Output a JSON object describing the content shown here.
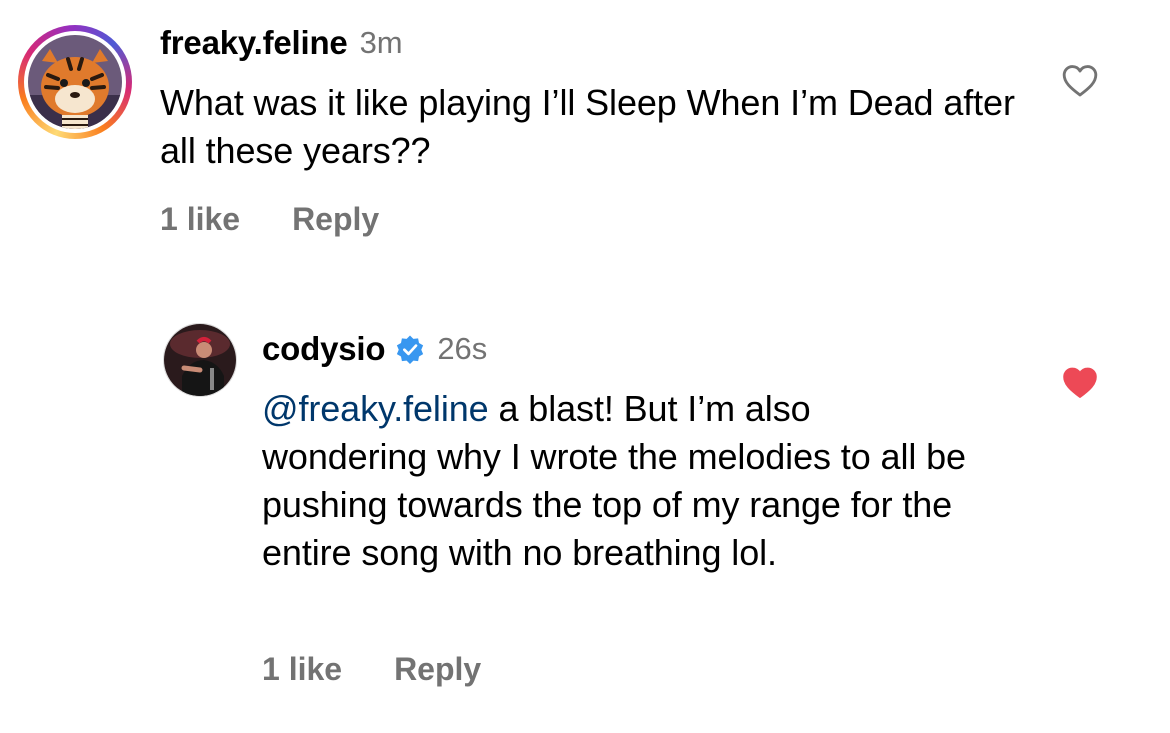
{
  "comments": [
    {
      "username": "freaky.feline",
      "time": "3m",
      "text": "What was it like playing I’ll Sleep When I’m Dead after all these years??",
      "likes": "1 like",
      "reply": "Reply",
      "liked": false,
      "avatar_icon": "tiger-avatar"
    },
    {
      "username": "codysio",
      "verified": true,
      "time": "26s",
      "mention": "@freaky.feline",
      "text": " a blast! But I’m also wondering why I wrote the melodies to all be pushing towards the top of my range for the entire song with no breathing lol.",
      "likes": "1 like",
      "reply": "Reply",
      "liked": true,
      "avatar_icon": "performer-avatar"
    }
  ],
  "colors": {
    "meta_gray": "#737373",
    "mention_blue": "#00376b",
    "heart_red": "#ed4956",
    "verified_blue": "#3897f0"
  }
}
